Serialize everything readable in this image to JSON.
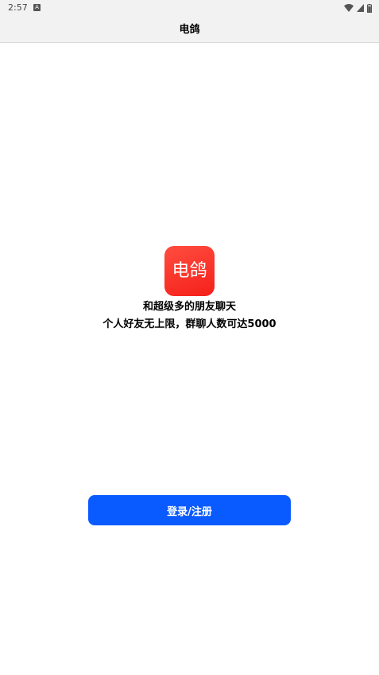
{
  "status_bar": {
    "time": "2:57",
    "notification_icon": "android-a-icon",
    "icons": [
      "wifi-icon",
      "signal-icon",
      "battery-icon"
    ]
  },
  "header": {
    "title": "电鸽"
  },
  "logo": {
    "text": "电鸽",
    "colors": {
      "top": "#ff4d3f",
      "bottom": "#f5201a"
    }
  },
  "tagline": {
    "line1": "和超级多的朋友聊天",
    "line2": "个人好友无上限，群聊人数可达5000"
  },
  "login_button": {
    "label": "登录/注册",
    "color": "#0a5bff"
  }
}
